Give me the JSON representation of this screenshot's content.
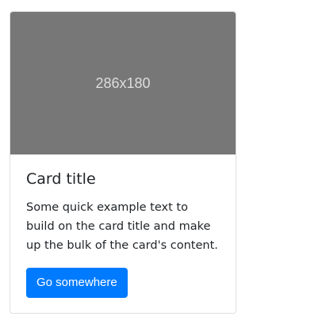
{
  "card": {
    "image_label": "286x180",
    "title": "Card title",
    "text": "Some quick example text to build on the card title and make up the bulk of the card's content.",
    "button_label": "Go somewhere"
  },
  "colors": {
    "primary": "#007bff",
    "image_placeholder": "#777777"
  }
}
